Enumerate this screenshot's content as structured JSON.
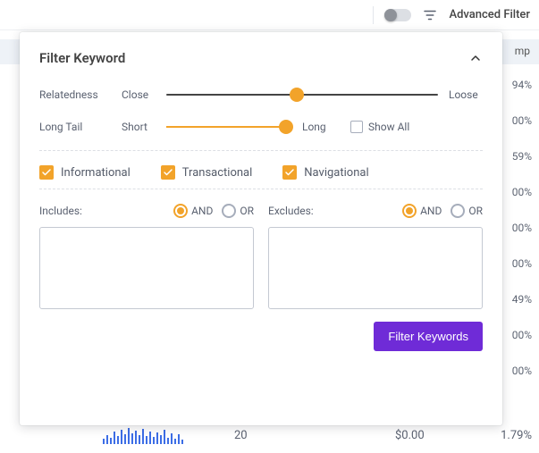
{
  "topbar": {
    "advanced_filter_label": "Advanced Filter"
  },
  "panel": {
    "title": "Filter Keyword",
    "relatedness": {
      "label": "Relatedness",
      "min_label": "Close",
      "max_label": "Loose",
      "value_pct": 48
    },
    "longtail": {
      "label": "Long Tail",
      "min_label": "Short",
      "max_label": "Long",
      "value_pct": 96,
      "show_all_label": "Show All"
    },
    "intents": {
      "informational": "Informational",
      "transactional": "Transactional",
      "navigational": "Navigational"
    },
    "includes": {
      "label": "Includes:",
      "and": "AND",
      "or": "OR",
      "selected": "AND"
    },
    "excludes": {
      "label": "Excludes:",
      "and": "AND",
      "or": "OR",
      "selected": "AND"
    },
    "submit_label": "Filter Keywords"
  },
  "background": {
    "column_hint": "mp",
    "right_values": [
      "94%",
      "00%",
      "59%",
      "00%",
      "00%",
      "00%",
      "49%",
      "00%",
      "00%"
    ],
    "bottom": {
      "volume": "20",
      "cost": "$0.00",
      "pct": "1.79%"
    }
  },
  "colors": {
    "accent_orange": "#f2a32a",
    "primary_purple": "#6f2bd7",
    "spark_blue": "#3d6ee6"
  }
}
